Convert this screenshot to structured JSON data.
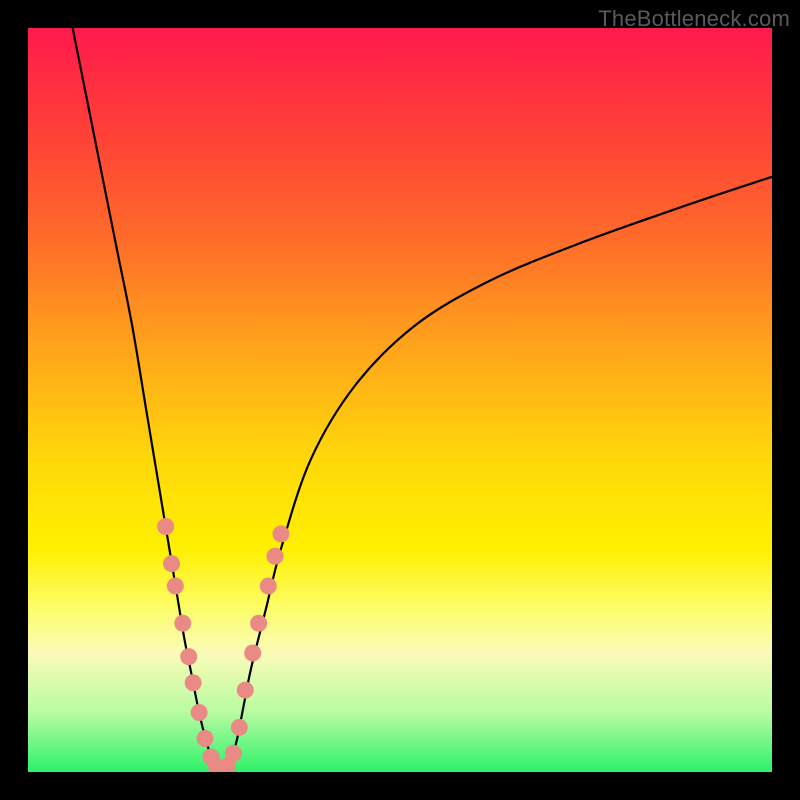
{
  "watermark": "TheBottleneck.com",
  "chart_data": {
    "type": "line",
    "title": "",
    "xlabel": "",
    "ylabel": "",
    "xlim": [
      0,
      100
    ],
    "ylim": [
      0,
      100
    ],
    "series": [
      {
        "name": "left-branch",
        "x": [
          6,
          8,
          10,
          12,
          14,
          16,
          18,
          20,
          21,
          22,
          23,
          24,
          25,
          26
        ],
        "y": [
          100,
          90,
          80,
          70,
          60,
          48,
          36,
          24,
          18,
          13,
          8,
          4,
          1,
          0
        ]
      },
      {
        "name": "right-branch",
        "x": [
          26,
          27,
          28,
          29,
          30,
          32,
          34,
          38,
          44,
          52,
          62,
          74,
          88,
          100
        ],
        "y": [
          0,
          1,
          4,
          9,
          14,
          22,
          30,
          42,
          52,
          60,
          66,
          71,
          76,
          80
        ]
      }
    ],
    "dots": {
      "name": "highlight-points",
      "color": "#e98a84",
      "points": [
        {
          "x": 18.5,
          "y": 33
        },
        {
          "x": 19.3,
          "y": 28
        },
        {
          "x": 19.8,
          "y": 25
        },
        {
          "x": 20.8,
          "y": 20
        },
        {
          "x": 21.6,
          "y": 15.5
        },
        {
          "x": 22.2,
          "y": 12
        },
        {
          "x": 23.0,
          "y": 8
        },
        {
          "x": 23.8,
          "y": 4.5
        },
        {
          "x": 24.6,
          "y": 2
        },
        {
          "x": 25.3,
          "y": 0.8
        },
        {
          "x": 26.0,
          "y": 0.4
        },
        {
          "x": 26.8,
          "y": 0.8
        },
        {
          "x": 27.6,
          "y": 2.5
        },
        {
          "x": 28.4,
          "y": 6
        },
        {
          "x": 29.2,
          "y": 11
        },
        {
          "x": 30.2,
          "y": 16
        },
        {
          "x": 31.0,
          "y": 20
        },
        {
          "x": 32.3,
          "y": 25
        },
        {
          "x": 33.2,
          "y": 29
        },
        {
          "x": 34.0,
          "y": 32
        }
      ]
    }
  }
}
